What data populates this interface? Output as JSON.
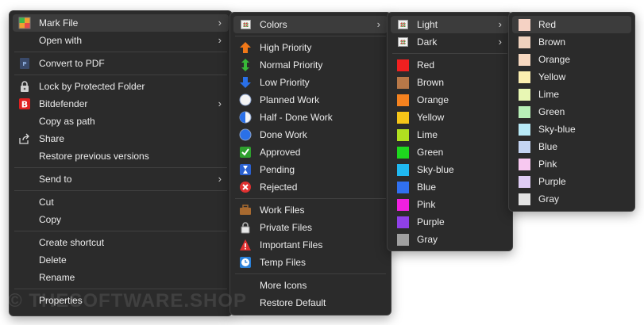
{
  "main_menu": {
    "items": [
      {
        "label": "Mark File",
        "icon": "mark-file-icon",
        "has_submenu": true,
        "highlighted": true
      },
      {
        "label": "Open with",
        "icon": "",
        "has_submenu": true
      },
      {
        "label": "Convert to PDF",
        "icon": "pdf-icon"
      },
      {
        "label": "Lock by Protected Folder",
        "icon": "lock-icon"
      },
      {
        "label": "Bitdefender",
        "icon": "bitdefender-icon",
        "has_submenu": true
      },
      {
        "label": "Copy as path",
        "icon": ""
      },
      {
        "label": "Share",
        "icon": "share-icon"
      },
      {
        "label": "Restore previous versions",
        "icon": ""
      },
      {
        "label": "Send to",
        "icon": "",
        "has_submenu": true
      },
      {
        "label": "Cut",
        "icon": ""
      },
      {
        "label": "Copy",
        "icon": ""
      },
      {
        "label": "Create shortcut",
        "icon": ""
      },
      {
        "label": "Delete",
        "icon": ""
      },
      {
        "label": "Rename",
        "icon": ""
      },
      {
        "label": "Properties",
        "icon": ""
      }
    ]
  },
  "mark_menu": {
    "items": [
      {
        "label": "Colors",
        "icon": "palette-icon",
        "has_submenu": true,
        "highlighted": true
      },
      {
        "label": "High Priority",
        "icon": "arrow-up-icon"
      },
      {
        "label": "Normal Priority",
        "icon": "arrows-updown-icon"
      },
      {
        "label": "Low Priority",
        "icon": "arrow-down-icon"
      },
      {
        "label": "Planned Work",
        "icon": "circle-empty-icon"
      },
      {
        "label": "Half - Done Work",
        "icon": "circle-half-icon"
      },
      {
        "label": "Done Work",
        "icon": "circle-full-icon"
      },
      {
        "label": "Approved",
        "icon": "check-icon"
      },
      {
        "label": "Pending",
        "icon": "hourglass-icon"
      },
      {
        "label": "Rejected",
        "icon": "x-icon"
      },
      {
        "label": "Work Files",
        "icon": "briefcase-icon"
      },
      {
        "label": "Private Files",
        "icon": "padlock-icon"
      },
      {
        "label": "Important Files",
        "icon": "warning-icon"
      },
      {
        "label": "Temp Files",
        "icon": "clock-icon"
      },
      {
        "label": "More Icons",
        "icon": ""
      },
      {
        "label": "Restore Default",
        "icon": ""
      }
    ]
  },
  "colors_menu": {
    "items": [
      {
        "label": "Light",
        "icon": "palette-icon",
        "has_submenu": true,
        "highlighted": true
      },
      {
        "label": "Dark",
        "icon": "palette-icon",
        "has_submenu": true
      },
      {
        "label": "Red",
        "color": "#f02020"
      },
      {
        "label": "Brown",
        "color": "#b87848"
      },
      {
        "label": "Orange",
        "color": "#f5821f"
      },
      {
        "label": "Yellow",
        "color": "#f5c518"
      },
      {
        "label": "Lime",
        "color": "#b0e020"
      },
      {
        "label": "Green",
        "color": "#1ed81e"
      },
      {
        "label": "Sky-blue",
        "color": "#20b8f0"
      },
      {
        "label": "Blue",
        "color": "#3070f0"
      },
      {
        "label": "Pink",
        "color": "#f020e0"
      },
      {
        "label": "Purple",
        "color": "#9040e8"
      },
      {
        "label": "Gray",
        "color": "#a0a0a0"
      }
    ]
  },
  "light_menu": {
    "items": [
      {
        "label": "Red",
        "color": "#f5d2c4",
        "highlighted": true
      },
      {
        "label": "Brown",
        "color": "#f0d2be"
      },
      {
        "label": "Orange",
        "color": "#f7d8c0"
      },
      {
        "label": "Yellow",
        "color": "#fcefb0"
      },
      {
        "label": "Lime",
        "color": "#e8f7b4"
      },
      {
        "label": "Green",
        "color": "#b8f0b8"
      },
      {
        "label": "Sky-blue",
        "color": "#b8eaf7"
      },
      {
        "label": "Blue",
        "color": "#c4d4f2"
      },
      {
        "label": "Pink",
        "color": "#f7c8f0"
      },
      {
        "label": "Purple",
        "color": "#e0cdf5"
      },
      {
        "label": "Gray",
        "color": "#e4e4e4"
      }
    ]
  },
  "watermark": "© THESOFTWARE.SHOP"
}
